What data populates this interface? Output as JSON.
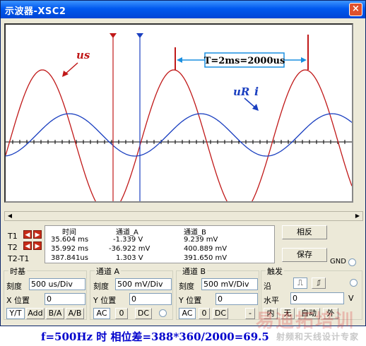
{
  "window": {
    "title": "示波器-XSC2",
    "close_glyph": "×"
  },
  "screen": {
    "annotations": {
      "us": "us",
      "ur": "uR",
      "i": "i",
      "period": "T=2ms=2000us"
    },
    "colors": {
      "channel_a": "#c01818",
      "channel_b": "#1a3fc0",
      "grid": "#000000",
      "cursor_1": "#c01818",
      "cursor_2": "#1a3fc0"
    }
  },
  "readout": {
    "headers": {
      "time": "时间",
      "channel_a": "通道_A",
      "channel_b": "通道_B"
    },
    "rows": [
      {
        "label": "T1",
        "time": "35.604 ms",
        "a": "-1.339 V",
        "b": "9.239 mV"
      },
      {
        "label": "T2",
        "time": "35.992 ms",
        "a": "-36.922 mV",
        "b": "400.889 mV"
      },
      {
        "label": "T2-T1",
        "time": "387.841us",
        "a": "1.303 V",
        "b": "391.650 mV"
      }
    ]
  },
  "buttons": {
    "reverse": "相反",
    "save": "保存",
    "gnd": "GND"
  },
  "timebase": {
    "title": "时基",
    "scale_label": "刻度",
    "scale_value": "500 us/Div",
    "xpos_label": "X 位置",
    "xpos_value": "0",
    "modes": [
      "Y/T",
      "Add",
      "B/A",
      "A/B"
    ]
  },
  "channel_a": {
    "title": "通道 A",
    "scale_label": "刻度",
    "scale_value": "500 mV/Div",
    "ypos_label": "Y 位置",
    "ypos_value": "0",
    "coupling": [
      "AC",
      "0",
      "DC"
    ]
  },
  "channel_b": {
    "title": "通道 B",
    "scale_label": "刻度",
    "scale_value": "500 mV/Div",
    "ypos_label": "Y 位置",
    "ypos_value": "0",
    "coupling": [
      "AC",
      "0",
      "DC",
      "-"
    ]
  },
  "trigger": {
    "title": "触发",
    "edge_label": "沿",
    "level_label": "水平",
    "level_value": "0",
    "level_unit": "V",
    "modes": [
      "内",
      "无",
      "自动",
      "外"
    ]
  },
  "caption": "f=500Hz 时 相位差=388*360/2000=69.5",
  "watermark": {
    "main": "易迪拓培训",
    "sub": "射频和天线设计专家"
  }
}
